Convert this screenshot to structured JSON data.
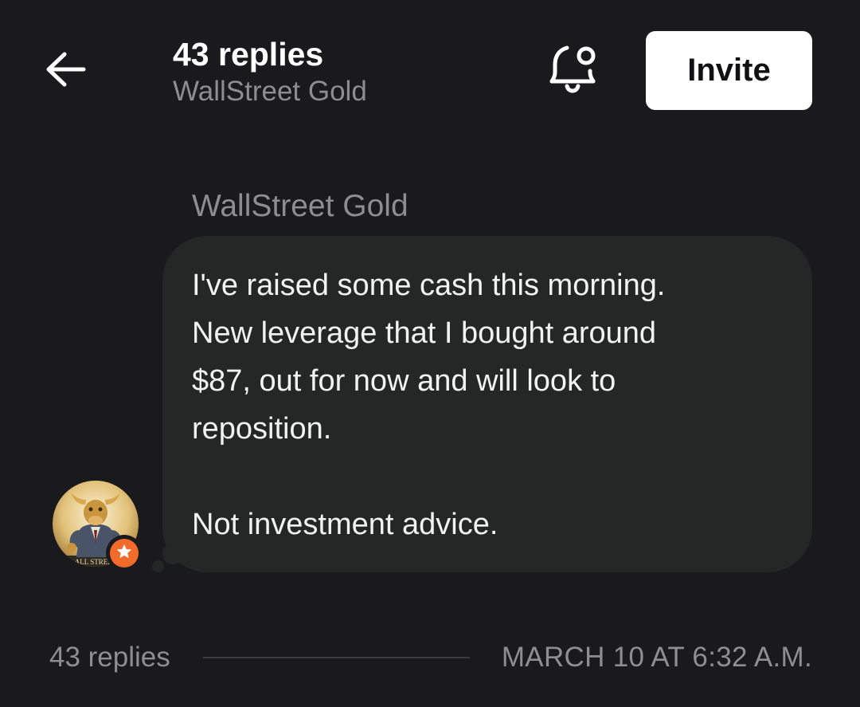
{
  "header": {
    "title": "43 replies",
    "subtitle": "WallStreet Gold",
    "invite_label": "Invite",
    "back_icon": "arrow-left-icon",
    "notification_icon": "bell-settings-icon"
  },
  "message": {
    "author": "WallStreet Gold",
    "text": "I've raised some cash this morning.\nNew leverage that I bought around\n$87, out for now and will look to\nreposition.\n\nNot investment advice.",
    "avatar_text": "ALL STREET",
    "badge_icon": "star-icon"
  },
  "footer": {
    "replies_label": "43 replies",
    "timestamp": "MARCH 10 AT 6:32 A.M."
  },
  "colors": {
    "background": "#1a1a1c",
    "bubble": "#252727",
    "muted_text": "#8d8d92",
    "badge": "#f26b2a"
  }
}
